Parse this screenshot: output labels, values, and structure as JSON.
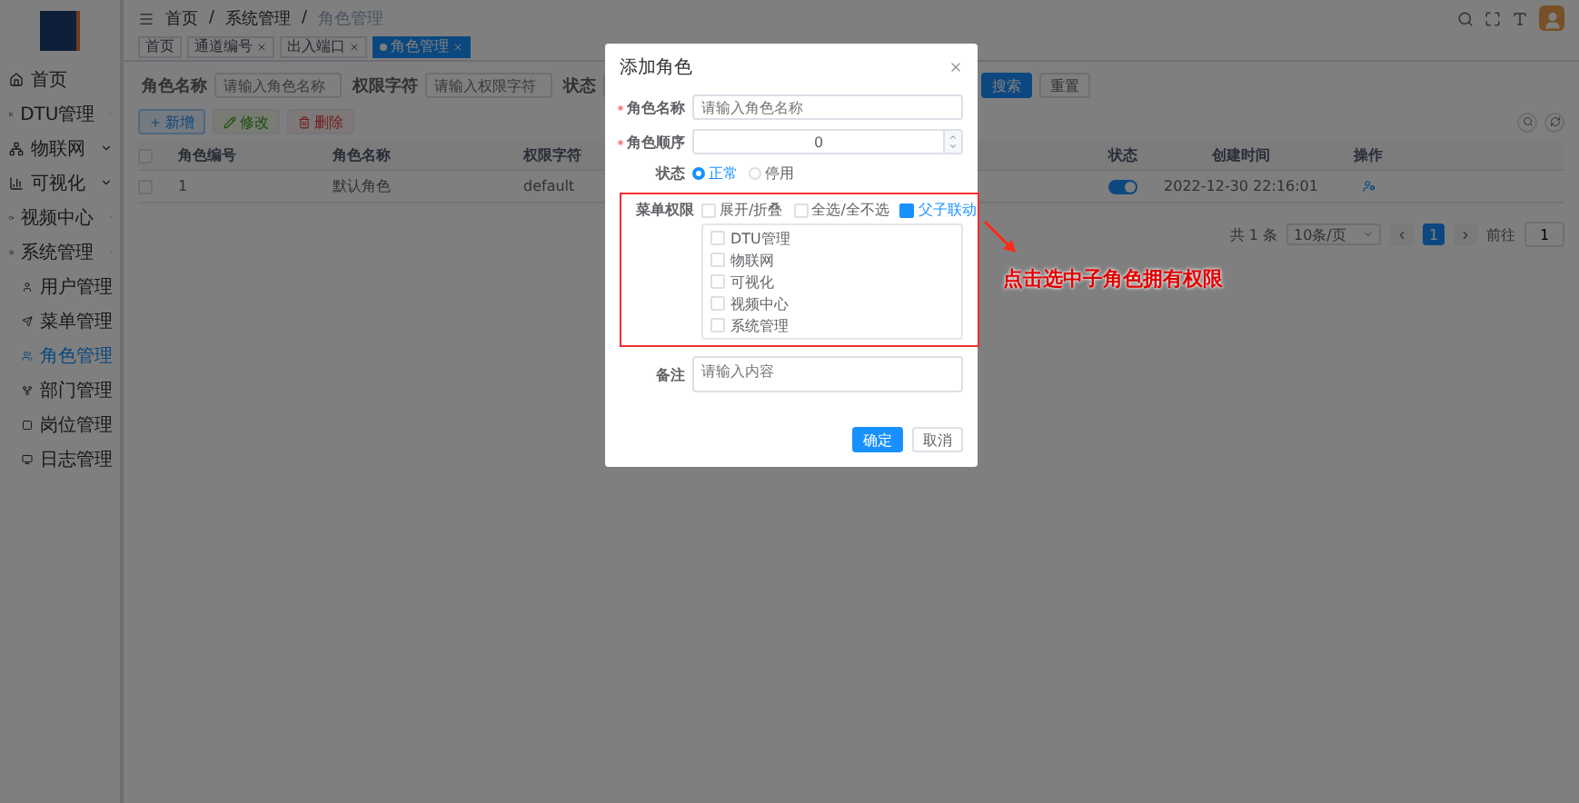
{
  "sidebar": {
    "items": [
      {
        "kind": "link",
        "label": "首页"
      },
      {
        "kind": "group",
        "label": "DTU管理",
        "expanded": false
      },
      {
        "kind": "group",
        "label": "物联网",
        "expanded": false
      },
      {
        "kind": "group",
        "label": "可视化",
        "expanded": false
      },
      {
        "kind": "group",
        "label": "视频中心",
        "expanded": false
      },
      {
        "kind": "group",
        "label": "系统管理",
        "expanded": true,
        "children": [
          {
            "label": "用户管理",
            "selected": false
          },
          {
            "label": "菜单管理",
            "selected": false
          },
          {
            "label": "角色管理",
            "selected": true
          },
          {
            "label": "部门管理",
            "selected": false
          },
          {
            "label": "岗位管理",
            "selected": false
          },
          {
            "label": "日志管理",
            "selected": false
          }
        ]
      }
    ]
  },
  "breadcrumb": {
    "separator": "/",
    "items": [
      "首页",
      "系统管理",
      "角色管理"
    ]
  },
  "tags": [
    {
      "label": "首页",
      "closable": false,
      "selected": false
    },
    {
      "label": "通道编号",
      "closable": true,
      "selected": false
    },
    {
      "label": "出入端口",
      "closable": true,
      "selected": false
    },
    {
      "label": "角色管理",
      "closable": true,
      "selected": true
    }
  ],
  "filters": [
    {
      "label": "角色名称",
      "placeholder": "请输入角色名称"
    },
    {
      "label": "权限字符",
      "placeholder": "请输入权限字符"
    },
    {
      "label": "状态"
    }
  ],
  "filter_buttons": [
    "搜索",
    "重置"
  ],
  "actions": [
    {
      "label": "新增",
      "kind": "primary",
      "disabled": false
    },
    {
      "label": "修改",
      "kind": "success",
      "disabled": true
    },
    {
      "label": "删除",
      "kind": "danger",
      "disabled": true
    }
  ],
  "table": {
    "all_checked": false,
    "columns": [
      "角色编号",
      "角色名称",
      "权限字符",
      "状态",
      "创建时间",
      "操作"
    ],
    "rows": [
      {
        "checked": false,
        "cells": [
          "1",
          "默认角色",
          "default"
        ],
        "on": true,
        "created": "2022-12-30 22:16:01"
      }
    ]
  },
  "pagination": {
    "total": "共 1 条",
    "page_size": "10条/页",
    "pages": [
      {
        "label": "1",
        "selected": true
      }
    ],
    "goto_label": "前往",
    "goto_value": "1"
  },
  "dialog": {
    "title": "添加角色",
    "name": {
      "label": "角色名称",
      "required": true,
      "placeholder": "请输入角色名称"
    },
    "order": {
      "label": "角色顺序",
      "required": true,
      "value": "0"
    },
    "status": {
      "label": "状态",
      "options": [
        {
          "label": "正常",
          "selected": true
        },
        {
          "label": "停用",
          "selected": false
        }
      ]
    },
    "menu": {
      "label": "菜单权限",
      "options": [
        {
          "label": "展开/折叠",
          "checked": false
        },
        {
          "label": "全选/全不选",
          "checked": false
        },
        {
          "label": "父子联动",
          "checked": true
        }
      ],
      "tree": [
        {
          "label": "DTU管理",
          "checked": false
        },
        {
          "label": "物联网",
          "checked": false
        },
        {
          "label": "可视化",
          "checked": false
        },
        {
          "label": "视频中心",
          "checked": false
        },
        {
          "label": "系统管理",
          "checked": false
        }
      ]
    },
    "remark": {
      "label": "备注",
      "placeholder": "请输入内容"
    },
    "buttons": [
      {
        "label": "确定",
        "kind": "primary"
      },
      {
        "label": "取消",
        "kind": "default"
      }
    ]
  },
  "annotation": "点击选中子角色拥有权限"
}
